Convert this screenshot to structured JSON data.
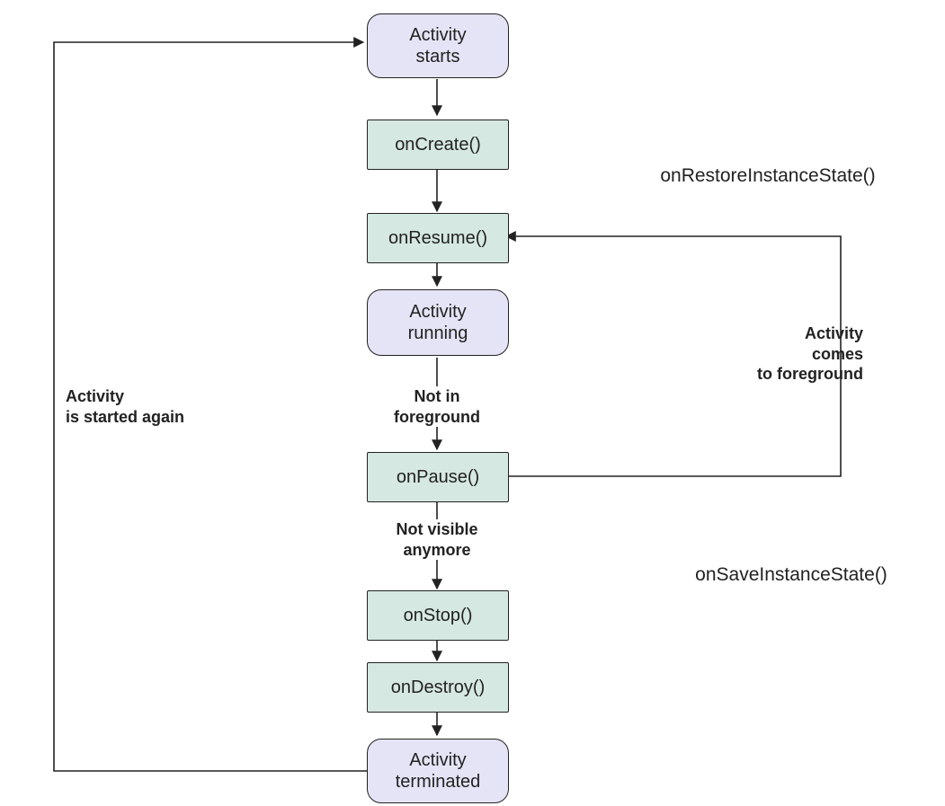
{
  "nodes": {
    "activity_starts": "Activity\nstarts",
    "on_create": "onCreate()",
    "on_resume": "onResume()",
    "activity_running": "Activity\nrunning",
    "on_pause": "onPause()",
    "on_stop": "onStop()",
    "on_destroy": "onDestroy()",
    "activity_terminated": "Activity\nterminated"
  },
  "labels": {
    "on_restore_instance": "onRestoreInstanceState()",
    "on_save_instance": "onSaveInstanceState()",
    "not_in_foreground": "Not in\nforeground",
    "not_visible": "Not visible\nanymore",
    "comes_to_foreground": "Activity\ncomes\nto foreground",
    "started_again": "Activity\nis started again"
  },
  "colors": {
    "state_fill": "#e4e4f6",
    "method_fill": "#d5e8e1",
    "stroke": "#222222"
  }
}
